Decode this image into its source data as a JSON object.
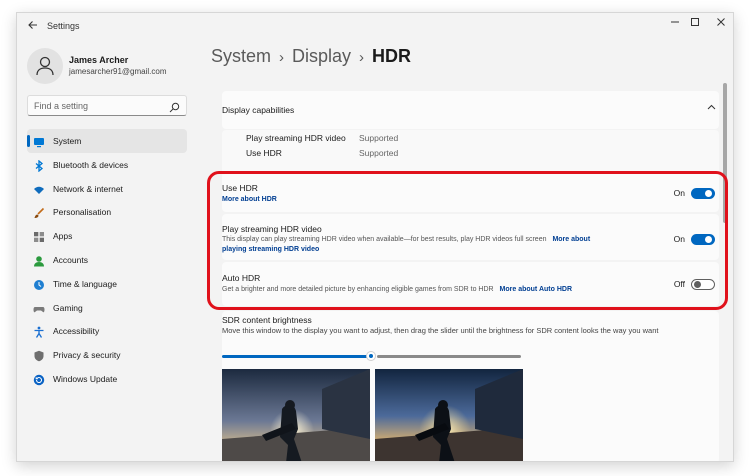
{
  "window": {
    "app_title": "Settings",
    "back_icon": "back-arrow-icon",
    "controls": [
      "minimize-icon",
      "maximize-icon",
      "close-icon"
    ]
  },
  "user": {
    "name": "James Archer",
    "email": "jamesarcher91@gmail.com"
  },
  "search": {
    "placeholder": "Find a setting"
  },
  "sidebar": {
    "active": "System",
    "items": [
      {
        "label": "System",
        "icon": "monitor-icon",
        "color": "#0078d4"
      },
      {
        "label": "Bluetooth & devices",
        "icon": "bluetooth-icon",
        "color": "#0078d4"
      },
      {
        "label": "Network & internet",
        "icon": "wifi-icon",
        "color": "#0f6cbd"
      },
      {
        "label": "Personalisation",
        "icon": "brush-icon",
        "color": "#c26a18"
      },
      {
        "label": "Apps",
        "icon": "apps-icon",
        "color": "#6b6b6b"
      },
      {
        "label": "Accounts",
        "icon": "person-icon",
        "color": "#2b9a3e"
      },
      {
        "label": "Time & language",
        "icon": "globe-clock-icon",
        "color": "#1f7fd1"
      },
      {
        "label": "Gaming",
        "icon": "gamepad-icon",
        "color": "#7a7a7a"
      },
      {
        "label": "Accessibility",
        "icon": "accessibility-icon",
        "color": "#1a6fd1"
      },
      {
        "label": "Privacy & security",
        "icon": "shield-icon",
        "color": "#6e6e6e"
      },
      {
        "label": "Windows Update",
        "icon": "update-icon",
        "color": "#0b63c4"
      }
    ]
  },
  "breadcrumb": {
    "items": [
      "System",
      "Display"
    ],
    "current": "HDR"
  },
  "capabilities": {
    "title": "Display capabilities",
    "rows": [
      {
        "key": "Play streaming HDR video",
        "value": "Supported"
      },
      {
        "key": "Use HDR",
        "value": "Supported"
      }
    ]
  },
  "settings": {
    "use_hdr": {
      "title": "Use HDR",
      "link": "More about HDR",
      "state": "On"
    },
    "streaming": {
      "title": "Play streaming HDR video",
      "desc": "This display can play streaming HDR video when available—for best results, play HDR videos full screen",
      "link1": "More about",
      "link2": "playing streaming HDR video",
      "state": "On"
    },
    "auto_hdr": {
      "title": "Auto HDR",
      "desc": "Get a brighter and more detailed picture by enhancing eligible games from SDR to HDR",
      "link": "More about Auto HDR",
      "state": "Off"
    }
  },
  "sdr": {
    "title": "SDR content brightness",
    "desc": "Move this window to the display you want to adjust, then drag the slider until the brightness for SDR content looks the way you want",
    "slider_value_fraction": 0.5
  },
  "colors": {
    "accent": "#0067c0",
    "highlight_annotation": "#e0111b"
  }
}
